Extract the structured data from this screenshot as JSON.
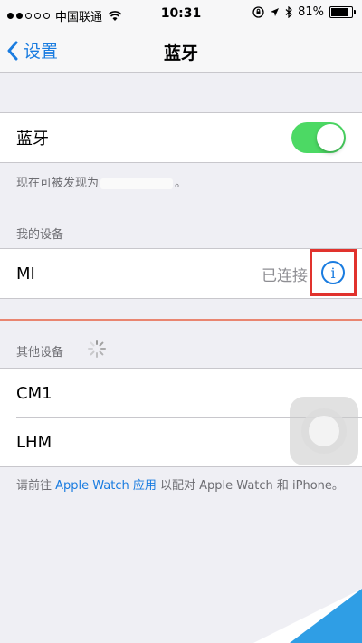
{
  "statusbar": {
    "carrier": "中国联通",
    "time": "10:31",
    "battery": "81%",
    "battery_level": 0.81,
    "wifi_icon": "wifi-icon",
    "lock_icon": "rotation-lock-icon",
    "location_icon": "location-icon",
    "bluetooth_icon": "bluetooth-icon"
  },
  "nav": {
    "back_label": "设置",
    "title": "蓝牙"
  },
  "bluetooth": {
    "label": "蓝牙",
    "enabled": true,
    "discoverable_prefix": "现在可被发现为",
    "discoverable_suffix": "。"
  },
  "my_devices": {
    "header": "我的设备",
    "items": [
      {
        "name": "MI",
        "status": "已连接"
      }
    ]
  },
  "other_devices": {
    "header": "其他设备",
    "items": [
      {
        "name": "CM1"
      },
      {
        "name": "LHM"
      }
    ]
  },
  "footer": {
    "prefix": "请前往 ",
    "link": "Apple Watch 应用",
    "suffix": " 以配对 Apple Watch 和 iPhone。"
  },
  "colors": {
    "accent": "#1a7ce0",
    "toggle_on": "#4cd964",
    "highlight": "#e1322d"
  }
}
